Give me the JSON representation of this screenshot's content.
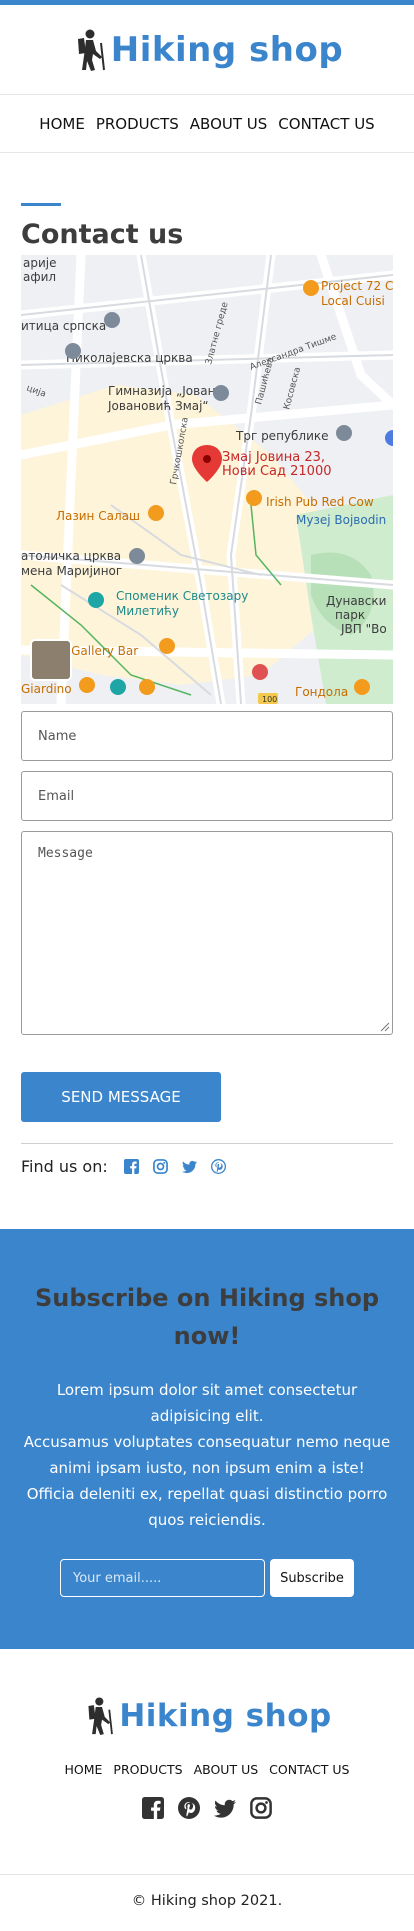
{
  "brand": {
    "name": "Hiking shop",
    "accent": "#3a85cc"
  },
  "nav": {
    "items": [
      "HOME",
      "PRODUCTS",
      "ABOUT US",
      "CONTACT US"
    ]
  },
  "contact": {
    "title": "Contact us",
    "map": {
      "address_line1": "Змај Јовина 23,",
      "address_line2": "Нови Сад 21000",
      "labels": [
        "арије",
        "афил",
        "итица српска",
        "Николајевска црква",
        "Гимназија „Јован",
        "Јовановић Змај“",
        "Трг републике",
        "Project 72 C",
        "Local Cuisi",
        "Irish Pub Red Cow",
        "Музеј Војвоdin",
        "Лазин Салаш",
        "атоличка црква",
        "мена Маријиног",
        "Споменик Светозару",
        "Милетићу",
        "Дунавски",
        "парк",
        "ЈВП \"Во",
        "tfe Gallery Bar",
        "Giardino",
        "Гондола",
        "100",
        "Александра Тишме",
        "Златне греде",
        "Пашићева",
        "Косовска",
        "Грчкошколска",
        "ција"
      ]
    },
    "form": {
      "name_placeholder": "Name",
      "email_placeholder": "Email",
      "message_placeholder": "Message",
      "submit_label": "SEND MESSAGE"
    },
    "find_us_label": "Find us on:",
    "social_icons": [
      "facebook-icon",
      "instagram-icon",
      "twitter-icon",
      "pinterest-icon"
    ]
  },
  "subscribe": {
    "title": "Subscribe on Hiking shop now!",
    "text_lines": [
      "Lorem ipsum dolor sit amet consectetur",
      "adipisicing elit.",
      "Accusamus voluptates consequatur nemo neque",
      "animi ipsam iusto, non ipsum enim a iste!",
      "Officia deleniti ex, repellat quasi distinctio porro",
      "quos reiciendis."
    ],
    "email_placeholder": "Your email.....",
    "button_label": "Subscribe"
  },
  "footer": {
    "nav": [
      "HOME",
      "PRODUCTS",
      "ABOUT US",
      "CONTACT US"
    ],
    "social_icons": [
      "facebook-icon",
      "pinterest-icon",
      "twitter-icon",
      "instagram-icon"
    ],
    "copyright": "© Hiking shop 2021."
  }
}
